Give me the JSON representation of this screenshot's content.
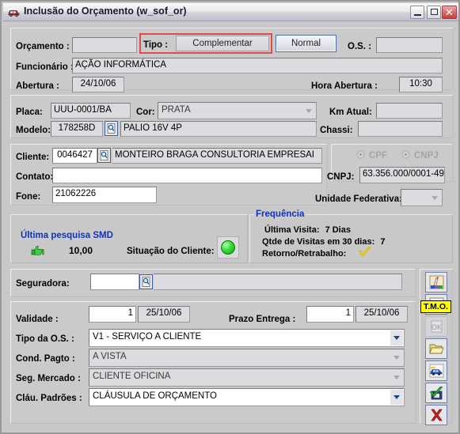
{
  "window": {
    "title": "Inclusão do Orçamento (w_sof_or)",
    "icon": "car-icon",
    "minimize_label": "–",
    "maximize_label": "□",
    "close_label": "✕"
  },
  "header": {
    "orcamento_label": "Orçamento :",
    "orcamento_value": "",
    "tipo_label": "Tipo :",
    "tipo_complementar": "Complementar",
    "tipo_normal": "Normal",
    "os_label": "O.S. :",
    "os_value": "",
    "funcionario_label": "Funcionário :",
    "funcionario_value": "AÇÃO INFORMÁTICA",
    "abertura_label": "Abertura :",
    "abertura_value": "24/10/06",
    "hora_abertura_label": "Hora Abertura :",
    "hora_abertura_value": "10:30"
  },
  "vehicle": {
    "placa_label": "Placa:",
    "placa_value": "UUU-0001/BA",
    "cor_label": "Cor:",
    "cor_value": "PRATA",
    "km_label": "Km Atual:",
    "km_value": "",
    "modelo_label": "Modelo:",
    "modelo_code": "178258D",
    "modelo_desc": "PALIO 16V 4P",
    "chassi_label": "Chassi:",
    "chassi_value": "",
    "lookup_icon": "search-lookup-icon"
  },
  "client": {
    "cliente_label": "Cliente:",
    "cliente_code": "0046427",
    "cliente_name": "MONTEIRO BRAGA CONSULTORIA EMPRESAI",
    "contato_label": "Contato:",
    "contato_value": "",
    "fone_label": "Fone:",
    "fone_value": "21062226",
    "cpf_label": "CPF",
    "cnpj_radio_label": "CNPJ",
    "cnpj_label": "CNPJ:",
    "cnpj_value": "63.356.000/0001-49",
    "uf_label": "Unidade Federativa:",
    "uf_value": "",
    "lookup_icon": "search-lookup-icon"
  },
  "smd": {
    "title": "Última pesquisa SMD",
    "icon": "thumbs-up-icon",
    "value": "10,00",
    "situacao_label": "Situação do Cliente:",
    "situacao_status": "green-light-icon"
  },
  "frequencia": {
    "title": "Frequência",
    "ultima_visita_label": "Última Visita:",
    "ultima_visita_value": "7 Dias",
    "qtde_visitas_label": "Qtde de Visitas em 30 dias:",
    "qtde_visitas_value": "7",
    "retorno_label": "Retorno/Retrabalho:",
    "retorno_icon": "yellow-check-icon"
  },
  "seguradora": {
    "label": "Seguradora:",
    "code": "",
    "name": "",
    "lookup_icon": "search-lookup-icon"
  },
  "prazos": {
    "validade_label": "Validade :",
    "validade_days": "1",
    "validade_date": "25/10/06",
    "prazo_label": "Prazo Entrega :",
    "prazo_days": "1",
    "prazo_date": "25/10/06"
  },
  "options": {
    "tipo_os_label": "Tipo da O.S. :",
    "tipo_os_value": "V1 - SERVIÇO A CLIENTE",
    "cond_pagto_label": "Cond. Pagto :",
    "cond_pagto_value": "A VISTA",
    "seg_mercado_label": "Seg. Mercado :",
    "seg_mercado_value": "CLIENTE OFICINA",
    "clau_padroes_label": "Cláu. Padrões :",
    "clau_padroes_value": "CLÁUSULA DE ORÇAMENTO"
  },
  "toolbar": {
    "tooltip": "T.M.O.",
    "buttons": [
      {
        "name": "paint-tools-icon"
      },
      {
        "name": "tmo-icon"
      },
      {
        "name": "check-ok-icon"
      },
      {
        "name": "open-folder-icon"
      },
      {
        "name": "vehicle-icon"
      },
      {
        "name": "save-confirm-icon"
      },
      {
        "name": "cancel-icon"
      }
    ]
  },
  "colors": {
    "accent_blue": "#1131c0",
    "highlight_red": "#e04a4a",
    "tooltip_yellow": "#ffff00",
    "status_green": "#3fe03f"
  }
}
